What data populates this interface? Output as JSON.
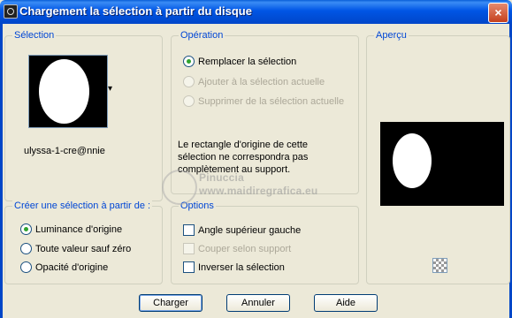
{
  "window": {
    "title": "Chargement la sélection à partir du disque",
    "close_label": "×"
  },
  "selection_group": {
    "title": "Sélection",
    "filename": "ulyssa-1-cre@nnie",
    "dropdown_icon": "▾"
  },
  "operation_group": {
    "title": "Opération",
    "options": [
      {
        "label": "Remplacer la sélection",
        "selected": true,
        "enabled": true
      },
      {
        "label": "Ajouter à la sélection actuelle",
        "selected": false,
        "enabled": false
      },
      {
        "label": "Supprimer de la sélection actuelle",
        "selected": false,
        "enabled": false
      }
    ],
    "note": "Le rectangle d'origine de cette sélection ne correspondra pas complètement au support."
  },
  "preview_group": {
    "title": "Aperçu"
  },
  "create_group": {
    "title": "Créer une sélection à partir de :",
    "options": [
      {
        "label": "Luminance d'origine",
        "selected": true
      },
      {
        "label": "Toute valeur sauf zéro",
        "selected": false
      },
      {
        "label": "Opacité d'origine",
        "selected": false
      }
    ]
  },
  "options_group": {
    "title": "Options",
    "checks": [
      {
        "label": "Angle supérieur gauche",
        "checked": false,
        "enabled": true
      },
      {
        "label": "Couper selon support",
        "checked": false,
        "enabled": false
      },
      {
        "label": "Inverser la sélection",
        "checked": false,
        "enabled": true
      }
    ]
  },
  "buttons": {
    "load": "Charger",
    "cancel": "Annuler",
    "help": "Aide"
  },
  "watermark": {
    "line1": "Pinuccia",
    "line2": "www.maidiregrafica.eu"
  },
  "colors": {
    "accent": "#0046d5",
    "title_bar": "#0055e5",
    "dialog_bg": "#ece9d8",
    "radio_selected": "#2fa32f"
  }
}
